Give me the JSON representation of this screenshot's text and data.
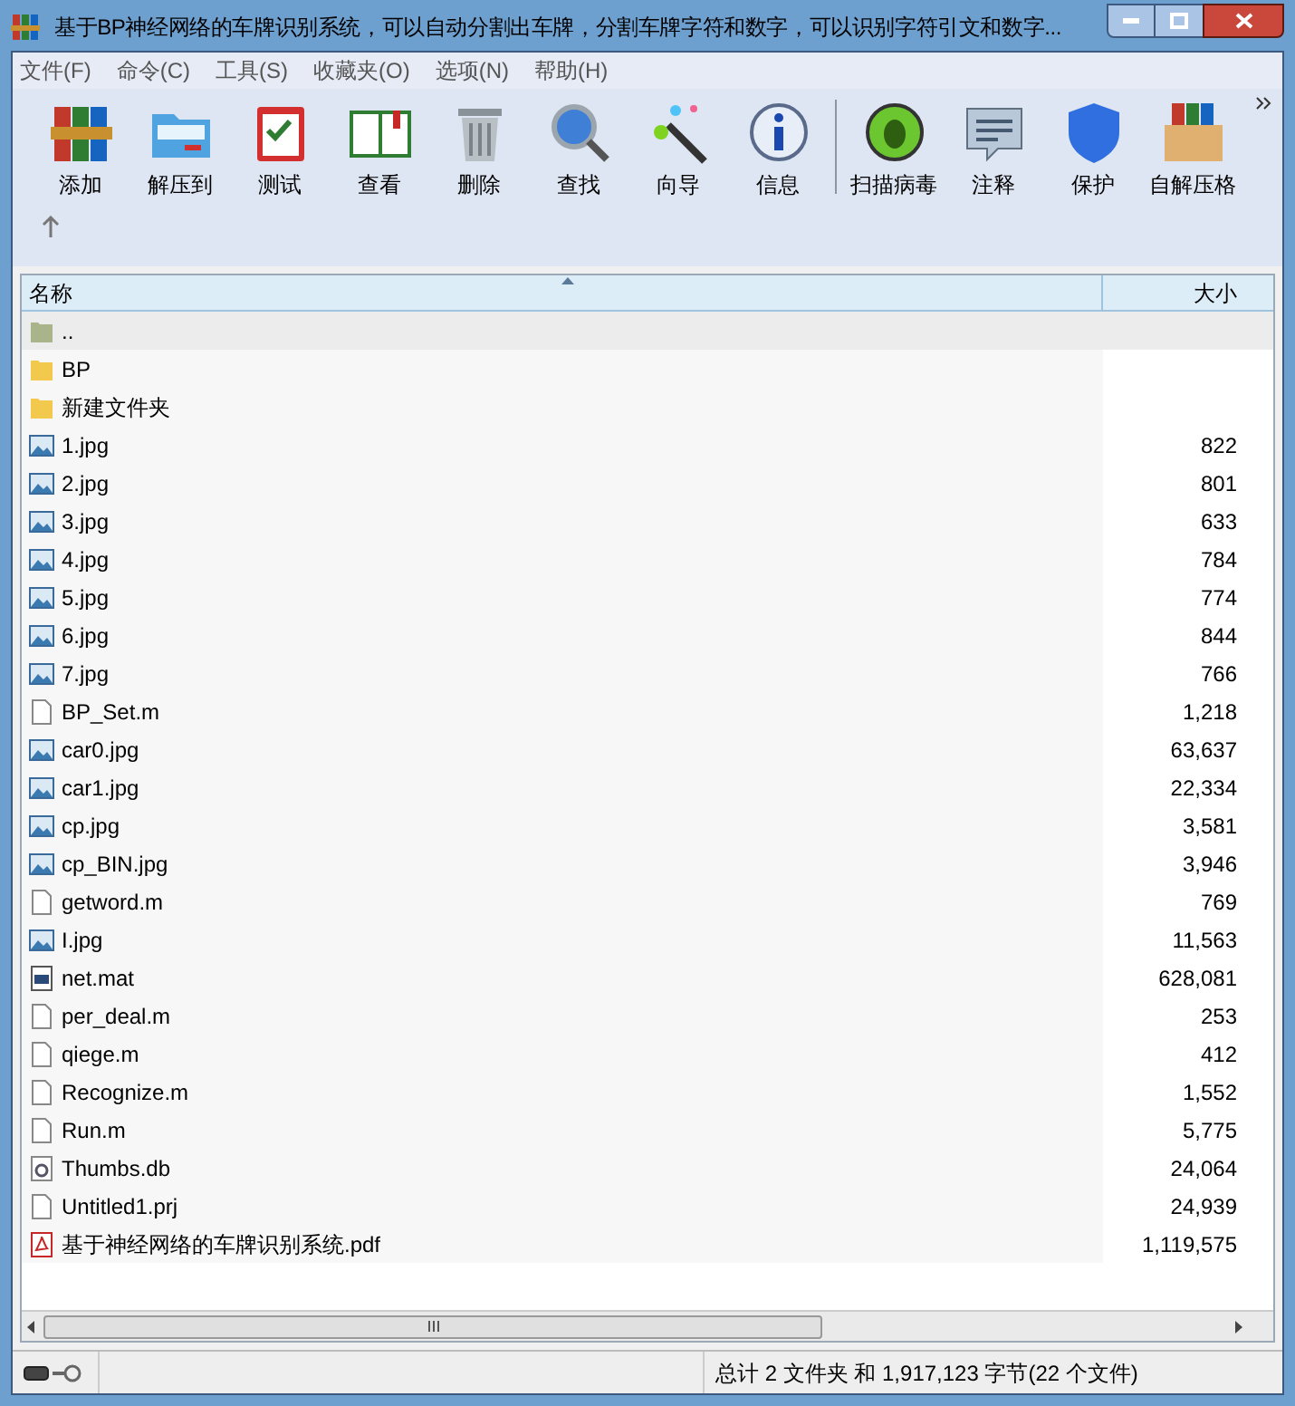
{
  "window": {
    "title": "基于BP神经网络的车牌识别系统，可以自动分割出车牌，分割车牌字符和数字，可以识别字符引文和数字..."
  },
  "menu": [
    "文件(F)",
    "命令(C)",
    "工具(S)",
    "收藏夹(O)",
    "选项(N)",
    "帮助(H)"
  ],
  "toolbar": [
    {
      "label": "添加",
      "kind": "add"
    },
    {
      "label": "解压到",
      "kind": "extract"
    },
    {
      "label": "测试",
      "kind": "test"
    },
    {
      "label": "查看",
      "kind": "view"
    },
    {
      "label": "删除",
      "kind": "delete"
    },
    {
      "label": "查找",
      "kind": "find"
    },
    {
      "label": "向导",
      "kind": "wizard"
    },
    {
      "label": "信息",
      "kind": "info"
    },
    {
      "label": "扫描病毒",
      "kind": "virus"
    },
    {
      "label": "注释",
      "kind": "comment"
    },
    {
      "label": "保护",
      "kind": "protect"
    },
    {
      "label": "自解压格",
      "kind": "sfx"
    }
  ],
  "table": {
    "columns": [
      "名称",
      "大小"
    ],
    "rows": [
      {
        "name": "..",
        "size": "",
        "kind": "parent",
        "selected": true
      },
      {
        "name": "BP",
        "size": "",
        "kind": "folder",
        "selected": false
      },
      {
        "name": "新建文件夹",
        "size": "",
        "kind": "folder",
        "selected": false
      },
      {
        "name": "1.jpg",
        "size": "822",
        "kind": "image",
        "selected": false
      },
      {
        "name": "2.jpg",
        "size": "801",
        "kind": "image",
        "selected": false
      },
      {
        "name": "3.jpg",
        "size": "633",
        "kind": "image",
        "selected": false
      },
      {
        "name": "4.jpg",
        "size": "784",
        "kind": "image",
        "selected": false
      },
      {
        "name": "5.jpg",
        "size": "774",
        "kind": "image",
        "selected": false
      },
      {
        "name": "6.jpg",
        "size": "844",
        "kind": "image",
        "selected": false
      },
      {
        "name": "7.jpg",
        "size": "766",
        "kind": "image",
        "selected": false
      },
      {
        "name": "BP_Set.m",
        "size": "1,218",
        "kind": "file",
        "selected": false
      },
      {
        "name": "car0.jpg",
        "size": "63,637",
        "kind": "image",
        "selected": false
      },
      {
        "name": "car1.jpg",
        "size": "22,334",
        "kind": "image",
        "selected": false
      },
      {
        "name": "cp.jpg",
        "size": "3,581",
        "kind": "image",
        "selected": false
      },
      {
        "name": "cp_BIN.jpg",
        "size": "3,946",
        "kind": "image",
        "selected": false
      },
      {
        "name": "getword.m",
        "size": "769",
        "kind": "file",
        "selected": false
      },
      {
        "name": "I.jpg",
        "size": "11,563",
        "kind": "image",
        "selected": false
      },
      {
        "name": "net.mat",
        "size": "628,081",
        "kind": "mat",
        "selected": false
      },
      {
        "name": "per_deal.m",
        "size": "253",
        "kind": "file",
        "selected": false
      },
      {
        "name": "qiege.m",
        "size": "412",
        "kind": "file",
        "selected": false
      },
      {
        "name": "Recognize.m",
        "size": "1,552",
        "kind": "file",
        "selected": false
      },
      {
        "name": "Run.m",
        "size": "5,775",
        "kind": "file",
        "selected": false
      },
      {
        "name": "Thumbs.db",
        "size": "24,064",
        "kind": "db",
        "selected": false
      },
      {
        "name": "Untitled1.prj",
        "size": "24,939",
        "kind": "file",
        "selected": false
      },
      {
        "name": "基于神经网络的车牌识别系统.pdf",
        "size": "1,119,575",
        "kind": "pdf",
        "selected": false
      }
    ]
  },
  "status_bar": {
    "summary": "总计 2 文件夹 和 1,917,123 字节(22 个文件)"
  }
}
